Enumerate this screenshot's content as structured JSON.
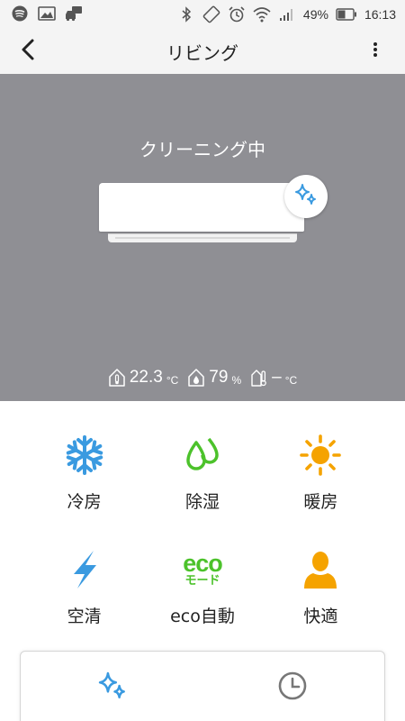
{
  "status_bar": {
    "left_icons": [
      "spotify-icon",
      "image-icon",
      "car-icon"
    ],
    "right_icons": [
      "bluetooth-icon",
      "rotation-icon",
      "alarm-icon",
      "wifi-icon",
      "signal-icon",
      "battery-icon"
    ],
    "battery_text": "49%",
    "time": "16:13"
  },
  "app_bar": {
    "title": "リビング",
    "back_icon": "chevron-left-icon",
    "more_icon": "more-vertical-icon"
  },
  "status_panel": {
    "status_text": "クリーニング中",
    "badge_icon": "sparkle-icon",
    "indoor_temp": {
      "icon": "house-thermometer-icon",
      "value": "22.3",
      "unit": "°C"
    },
    "humidity": {
      "icon": "house-drop-icon",
      "value": "79",
      "unit": "%"
    },
    "outdoor_temp": {
      "icon": "outdoor-thermometer-icon",
      "value": "–",
      "unit": "°C"
    }
  },
  "modes": [
    {
      "label": "冷房",
      "icon": "snowflake-icon",
      "color": "#3a9ae0"
    },
    {
      "label": "除湿",
      "icon": "droplets-icon",
      "color": "#4cc22b"
    },
    {
      "label": "暖房",
      "icon": "sun-icon",
      "color": "#f5a300"
    },
    {
      "label": "空清",
      "icon": "lightning-icon",
      "color": "#3a9ae0"
    },
    {
      "label": "eco自動",
      "icon": "eco-mode-icon",
      "icon_text": "eco",
      "icon_subtext": "モード",
      "color": "#4cc22b"
    },
    {
      "label": "快適",
      "icon": "person-icon",
      "color": "#f5a300"
    }
  ],
  "bottom_card": {
    "left_icon": "sparkle-icon",
    "right_icon": "clock-icon"
  },
  "colors": {
    "panel_bg": "#8f8f94",
    "blue": "#3a9ae0",
    "green": "#4cc22b",
    "orange": "#f5a300"
  }
}
